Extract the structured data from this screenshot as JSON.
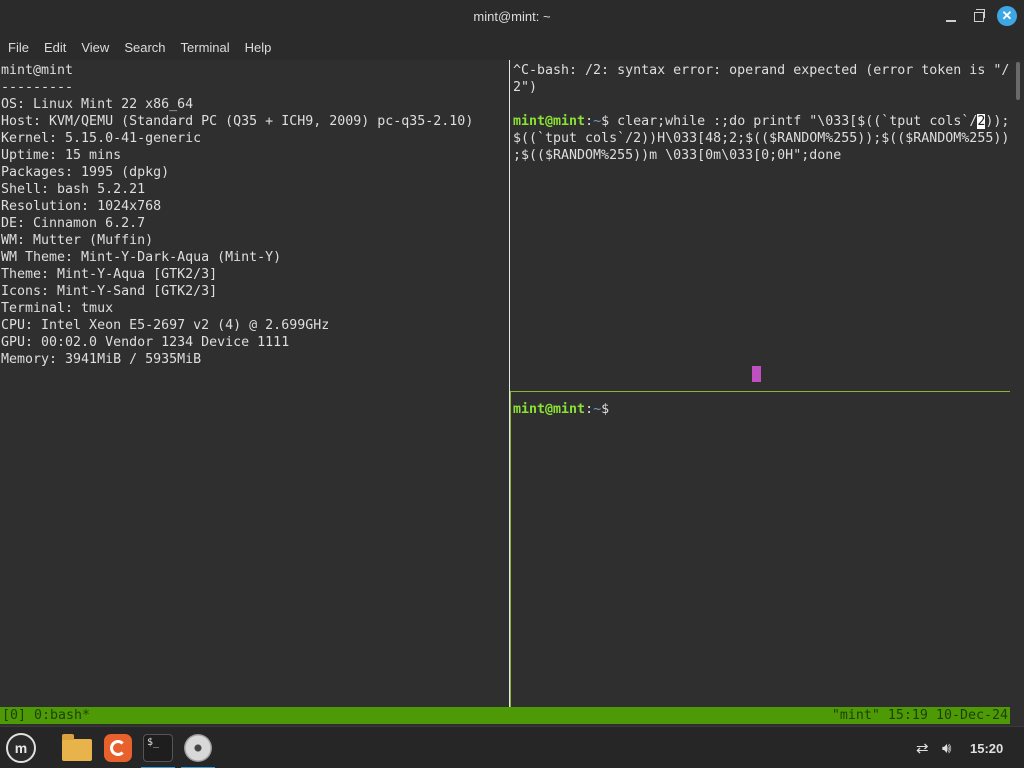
{
  "window": {
    "title": "mint@mint: ~"
  },
  "menu": [
    "File",
    "Edit",
    "View",
    "Search",
    "Terminal",
    "Help"
  ],
  "left_pane": {
    "lines": [
      "mint@mint",
      "---------",
      "OS: Linux Mint 22 x86_64",
      "Host: KVM/QEMU (Standard PC (Q35 + ICH9, 2009) pc-q35-2.10)",
      "Kernel: 5.15.0-41-generic",
      "Uptime: 15 mins",
      "Packages: 1995 (dpkg)",
      "Shell: bash 5.2.21",
      "Resolution: 1024x768",
      "DE: Cinnamon 6.2.7",
      "WM: Mutter (Muffin)",
      "WM Theme: Mint-Y-Dark-Aqua (Mint-Y)",
      "Theme: Mint-Y-Aqua [GTK2/3]",
      "Icons: Mint-Y-Sand [GTK2/3]",
      "Terminal: tmux",
      "CPU: Intel Xeon E5-2697 v2 (4) @ 2.699GHz",
      "GPU: 00:02.0 Vendor 1234 Device 1111",
      "Memory: 3941MiB / 5935MiB"
    ]
  },
  "right_top": {
    "error_line1": "^C-bash: /2: syntax error: operand expected (error token is \"/",
    "error_line2": "2\")",
    "prompt_user": "mint@mint",
    "prompt_sep": ":",
    "prompt_dir": "~",
    "prompt_sign": "$ ",
    "cmd_part1": "clear;while :;do printf \"\\033[$((`tput cols`/",
    "cmd_cursor": "2",
    "cmd_part2": "));",
    "cmd_line2": "$((`tput cols`/2))H\\033[48;2;$(($RANDOM%255));$(($RANDOM%255))",
    "cmd_line3": ";$(($RANDOM%255))m \\033[0m\\033[0;0H\";done"
  },
  "right_bottom": {
    "prompt_user": "mint@mint",
    "prompt_sep": ":",
    "prompt_dir": "~",
    "prompt_sign": "$"
  },
  "tmux": {
    "left": "[0] 0:bash*",
    "right": "\"mint\" 15:19 10-Dec-24"
  },
  "taskbar": {
    "clock": "15:20",
    "icons": [
      "mint-menu-icon",
      "files-icon",
      "firefox-icon",
      "terminal-icon",
      "disc-icon"
    ],
    "term_icon_text": "$_"
  },
  "colors": {
    "prompt_green": "#8ae234",
    "path_blue": "#729fcf",
    "tmux_green": "#4e9a06",
    "close_blue": "#3da7e3",
    "random_block": "#c050c0"
  }
}
